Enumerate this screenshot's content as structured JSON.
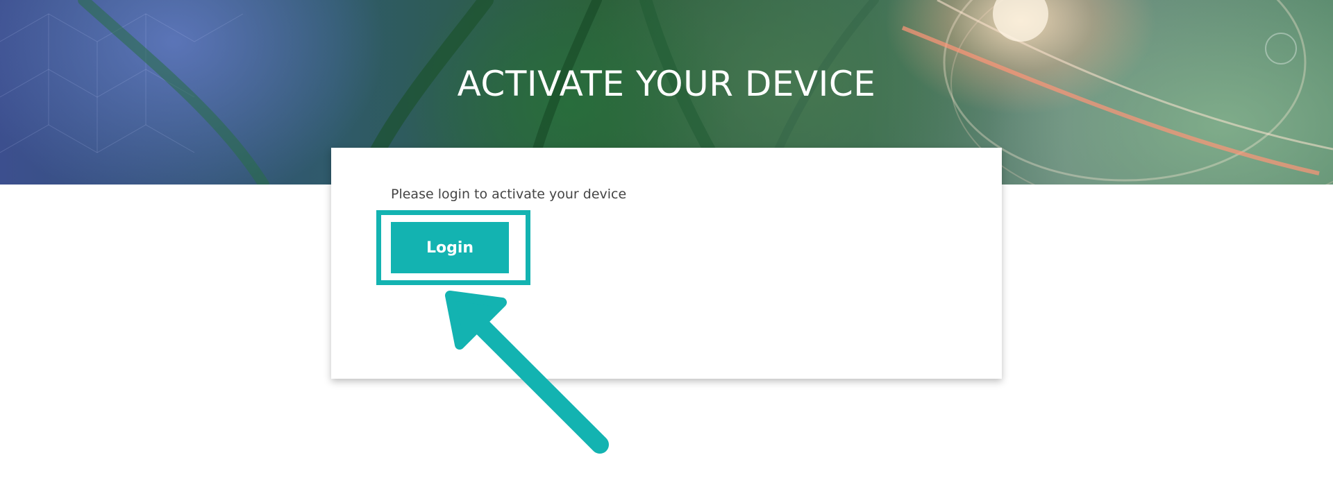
{
  "header": {
    "title": "ACTIVATE YOUR DEVICE"
  },
  "card": {
    "prompt": "Please login to activate your device",
    "login_label": "Login"
  },
  "colors": {
    "accent": "#13b3b1",
    "title_text": "#ffffff",
    "body_text": "#444444"
  },
  "icons": {
    "annotation_arrow": "pointer-arrow-icon"
  }
}
